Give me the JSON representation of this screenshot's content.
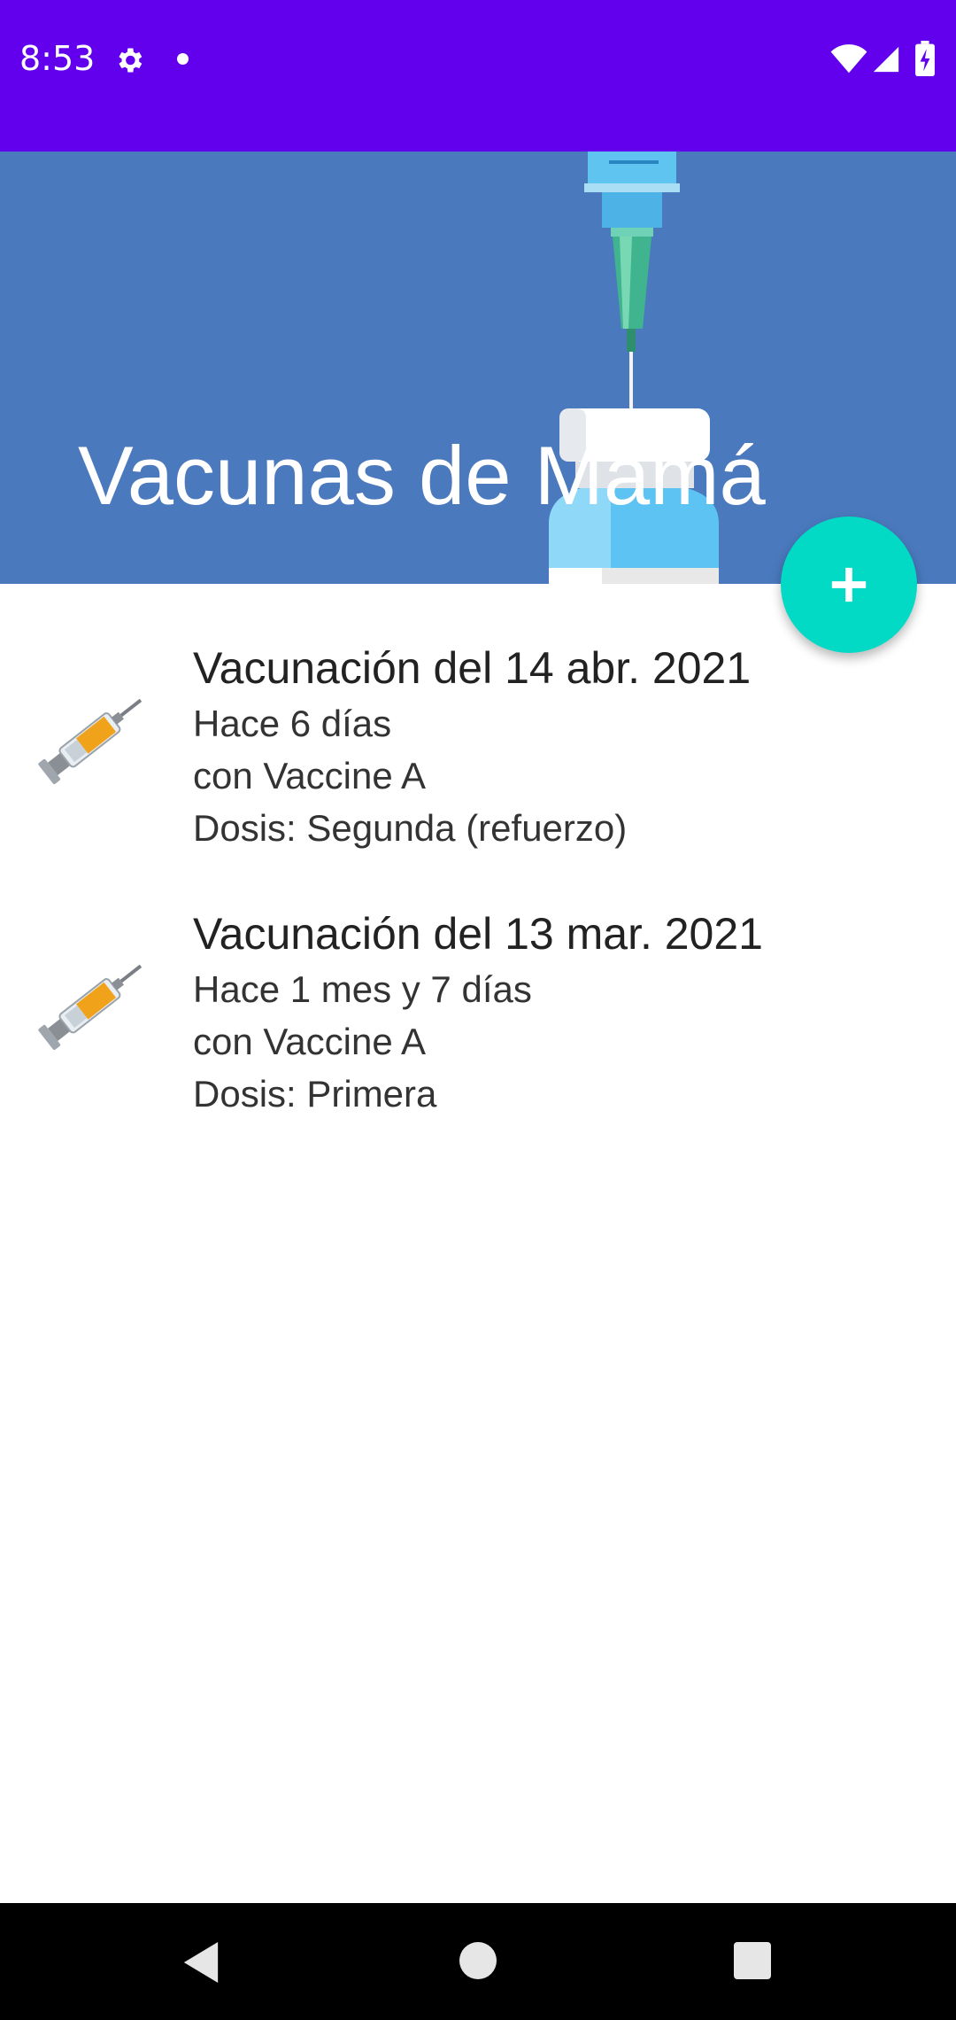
{
  "status_bar": {
    "time": "8:53",
    "icons": [
      "gear-icon",
      "notification-dot-icon",
      "wifi-icon",
      "cell-signal-icon",
      "battery-charging-icon"
    ],
    "background_color": "#6200ee"
  },
  "header": {
    "title": "Vacunas de Mamá",
    "background_color": "#4a79bd",
    "art": "vaccine-vial-illustration"
  },
  "fab": {
    "icon": "plus-icon",
    "color": "#03dac5"
  },
  "vaccinations": [
    {
      "title": "Vacunación del 14 abr. 2021",
      "elapsed": "Hace 6 días",
      "vaccine": "con Vaccine A",
      "dose": "Dosis: Segunda (refuerzo)",
      "icon": "syringe-icon"
    },
    {
      "title": "Vacunación del 13 mar. 2021",
      "elapsed": "Hace 1 mes y 7 días",
      "vaccine": "con Vaccine A",
      "dose": "Dosis: Primera",
      "icon": "syringe-icon"
    }
  ],
  "nav_bar": {
    "icons": [
      "back-icon",
      "home-icon",
      "recents-icon"
    ]
  }
}
